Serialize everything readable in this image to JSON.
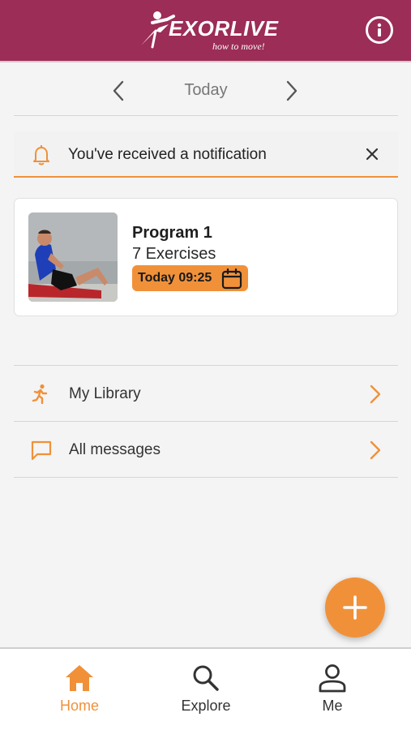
{
  "colors": {
    "brand": "#9b2d56",
    "accent": "#f0913a"
  },
  "header": {
    "logo_text": "EXORLIVE",
    "logo_tagline": "how to move!",
    "info_icon": "info-icon"
  },
  "date_nav": {
    "label": "Today",
    "prev_icon": "chevron-left-icon",
    "next_icon": "chevron-right-icon"
  },
  "notification": {
    "text": "You've received a notification",
    "icon": "bell-icon",
    "close_icon": "close-icon"
  },
  "program": {
    "title": "Program 1",
    "exercises": "7 Exercises",
    "date": "Today 09:25",
    "calendar_icon": "calendar-icon"
  },
  "list": {
    "items": [
      {
        "label": "My Library",
        "icon": "running-person-icon"
      },
      {
        "label": "All messages",
        "icon": "message-icon"
      }
    ]
  },
  "fab": {
    "icon": "plus-icon"
  },
  "bottom_nav": {
    "items": [
      {
        "label": "Home",
        "icon": "home-icon",
        "active": true
      },
      {
        "label": "Explore",
        "icon": "search-icon",
        "active": false
      },
      {
        "label": "Me",
        "icon": "user-icon",
        "active": false
      }
    ]
  }
}
